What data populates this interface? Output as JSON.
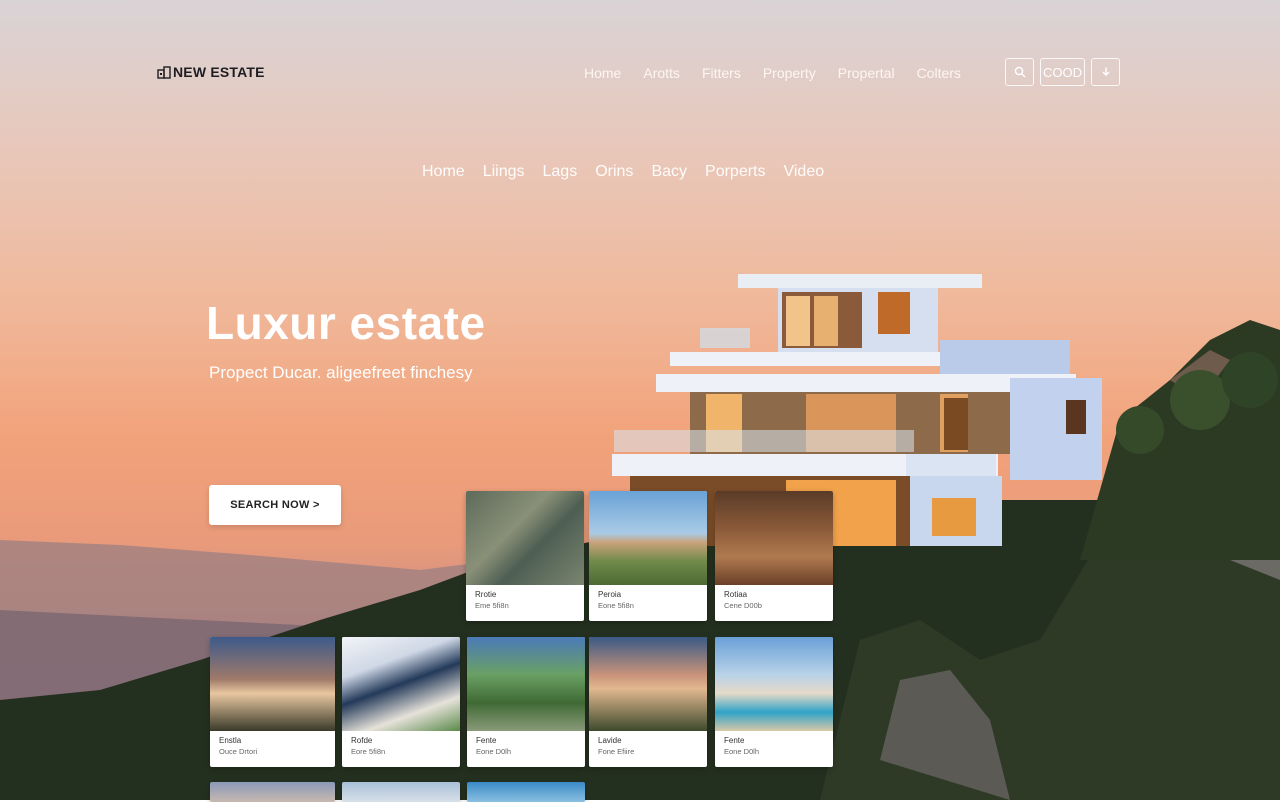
{
  "brand": {
    "name": "NEW ESTATE",
    "icon": "building-icon"
  },
  "top_nav": [
    "Home",
    "Arotts",
    "Fitters",
    "Property",
    "Propertal",
    "Colters"
  ],
  "top_actions": {
    "search_icon": "search-icon",
    "label": "COOD",
    "download_icon": "download-icon"
  },
  "sub_nav": [
    "Home",
    "Liings",
    "Lags",
    "Orins",
    "Bacy",
    "Porperts",
    "Video"
  ],
  "hero": {
    "title": "Luxur estate",
    "subtitle": "Propect Ducar. aligeefreet finchesy",
    "cta_label": "SEARCH NOW >"
  },
  "cards_row1": [
    {
      "title": "Rrotie",
      "detail": "Eme 5fi8n"
    },
    {
      "title": "Peroia",
      "detail": "Eone 5fi8n"
    },
    {
      "title": "Rotiaa",
      "detail": "Cene D00b"
    }
  ],
  "cards_row2": [
    {
      "title": "Enstla",
      "detail": "Ouce Drtori"
    },
    {
      "title": "Rofde",
      "detail": "Eore 5fi8n"
    },
    {
      "title": "Fente",
      "detail": "Eone D0lh"
    },
    {
      "title": "Lavide",
      "detail": "Fone Efiire"
    },
    {
      "title": "Fente",
      "detail": "Eone D0lh"
    }
  ]
}
